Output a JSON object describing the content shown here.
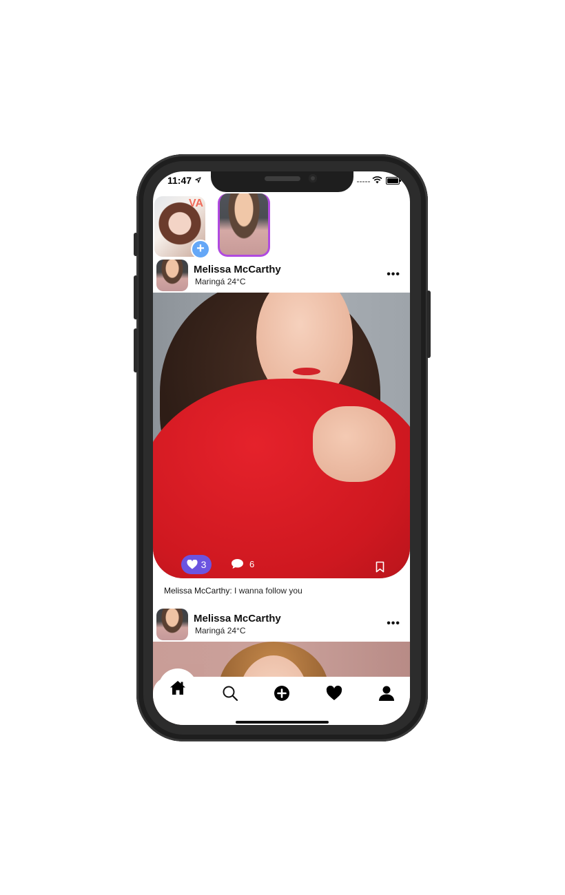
{
  "status_bar": {
    "time": "11:47"
  },
  "stories": [
    {
      "label": "VA"
    },
    {
      "label": ""
    }
  ],
  "posts": [
    {
      "author": "Melissa McCarthy",
      "location": "Maringá 24°C",
      "likes": "3",
      "comments": "6",
      "caption_author": "Melissa McCarthy",
      "caption_text": ": I wanna follow you"
    },
    {
      "author": "Melissa McCarthy",
      "location": "Maringá 24°C"
    }
  ],
  "tabbar": {
    "items": [
      "home-icon",
      "search-icon",
      "add-circle-icon",
      "heart-icon",
      "profile-icon"
    ],
    "active": "home-icon"
  },
  "colors": {
    "like_pill": "#6b54e0",
    "story_ring": "#b04ae0",
    "add_badge": "#64a7f7",
    "home_accent": "#c99d97"
  }
}
